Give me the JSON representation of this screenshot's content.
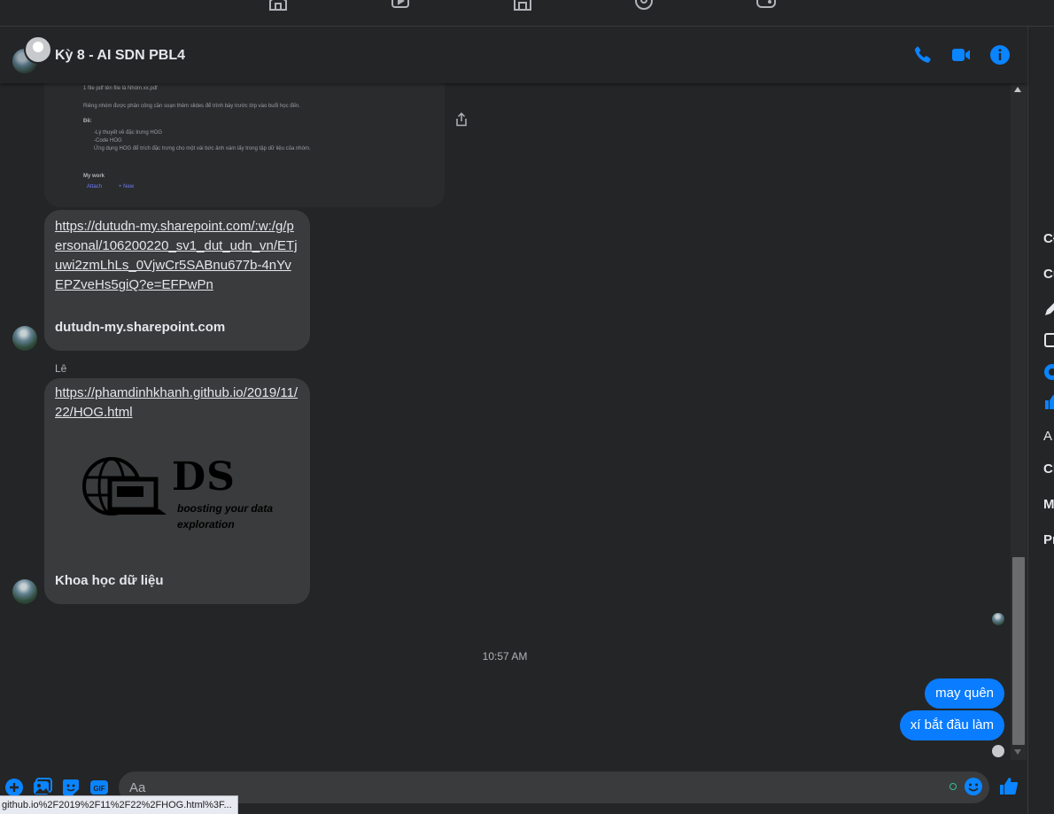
{
  "nav": {
    "icons": [
      "home-icon",
      "watch-icon",
      "marketplace-icon",
      "groups-icon",
      "gaming-icon"
    ]
  },
  "header": {
    "title": "Kỳ 8 - AI SDN PBL4",
    "actions": [
      "phone-icon",
      "video-icon",
      "info-icon"
    ]
  },
  "doc_preview": {
    "lines": [
      "1 file pdf tên file là Nhóm.xx.pdf",
      "Riêng nhóm được phân công cần soạn thêm slides để trình bày trước lớp vào buổi học đến.",
      "Đề:",
      "-Lý thuyết về đặc trưng HOG",
      "-Code HOG",
      "Ứng dụng HOG để trích đặc trưng cho một vài bức ảnh xám lấy trong tập dữ liệu của nhóm.",
      "My work"
    ],
    "attach_label": "Attach",
    "new_label": "+ New"
  },
  "messages": {
    "link1": {
      "url": "https://dutudn-my.sharepoint.com/:w:/g/personal/106200220_sv1_dut_udn_vn/ETjuwi2zmLhLs_0VjwCr5SABnu677b-4nYvEPZveHs5giQ?e=EFPwPn",
      "domain": "dutudn-my.sharepoint.com"
    },
    "sender": "Lê",
    "link2": {
      "url": "https://phamdinhkhanh.github.io/2019/11/22/HOG.html",
      "logo_text": "DS",
      "logo_tagline_1": "boosting your data",
      "logo_tagline_2": "exploration",
      "title": "Khoa học dữ liệu"
    },
    "timestamp": "10:57 AM",
    "mine": [
      "may quên",
      "xí bắt đầu làm"
    ]
  },
  "right_panel": {
    "items": [
      "Cł",
      "Cu",
      "A",
      "Cl",
      "M",
      "Pr"
    ]
  },
  "composer": {
    "placeholder": "Aa",
    "buttons": [
      "add-icon",
      "photo-icon",
      "sticker-icon",
      "gif-icon"
    ],
    "gif_label": "GIF"
  },
  "status_url": "github.io%2F2019%2F11%2F22%2FHOG.html%3F...",
  "colors": {
    "accent": "#0a84ff",
    "bubble_mine": "#0a7cff",
    "bubble_other": "#3a3b3c",
    "background": "#242526"
  }
}
